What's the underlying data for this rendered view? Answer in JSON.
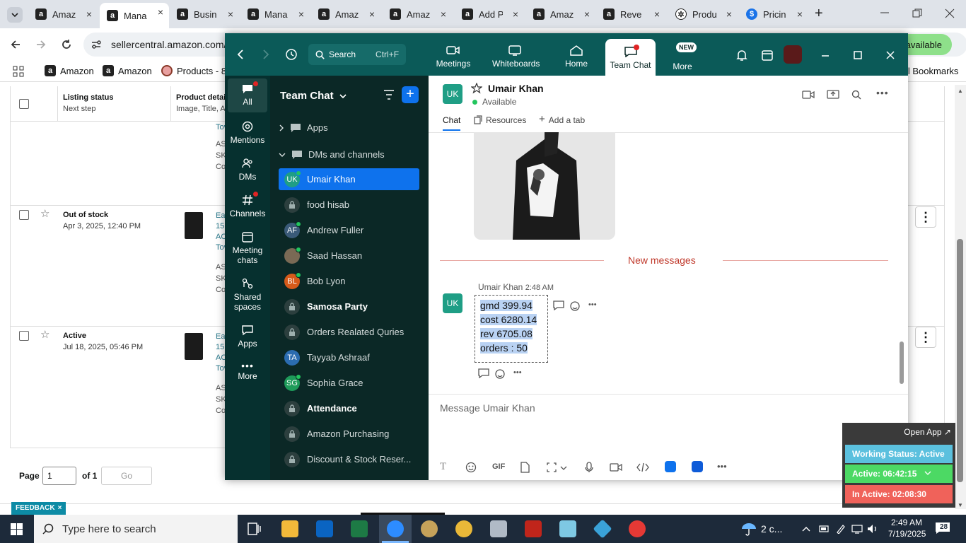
{
  "browser": {
    "tabs": [
      {
        "label": "Amaz",
        "icon": "a"
      },
      {
        "label": "Mana",
        "icon": "a"
      },
      {
        "label": "Busin",
        "icon": "a"
      },
      {
        "label": "Mana",
        "icon": "a"
      },
      {
        "label": "Amaz",
        "icon": "a"
      },
      {
        "label": "Amaz",
        "icon": "a"
      },
      {
        "label": "Add P",
        "icon": "a"
      },
      {
        "label": "Amaz",
        "icon": "a"
      },
      {
        "label": "Reve",
        "icon": "a"
      },
      {
        "label": "Produ",
        "icon": "globe"
      },
      {
        "label": "Pricin",
        "icon": "dollar"
      }
    ],
    "url": "sellercentral.amazon.com/",
    "bookmarks": [
      "Amazon",
      "Amazon",
      "Products - 88"
    ],
    "all_bookmarks": "ll Bookmarks",
    "available_pill": "available"
  },
  "amazon": {
    "headers": {
      "listing_status": "Listing status",
      "next_step": "Next step",
      "product_details": "Product detail",
      "product_sub": "Image, Title, A"
    },
    "rows": [
      {
        "status": "Out of stock",
        "date": "Apr 3, 2025, 12:40 PM"
      },
      {
        "status": "Active",
        "date": "Jul 18, 2025, 05:46 PM"
      }
    ],
    "cell_frag": {
      "to": "Tov",
      "as": "AS",
      "sk": "SK",
      "co": "Co",
      "ea": "Ea",
      "n15": "15",
      "ac": "AC"
    },
    "pagination": {
      "page_label": "Page",
      "page_value": "1",
      "of_label": "of 1",
      "go_label": "Go"
    },
    "feedback": "FEEDBACK"
  },
  "teams": {
    "search": {
      "label": "Search",
      "shortcut": "Ctrl+F"
    },
    "nav": [
      {
        "label": "Meetings"
      },
      {
        "label": "Whiteboards"
      },
      {
        "label": "Home"
      },
      {
        "label": "Team Chat"
      },
      {
        "label": "More",
        "badge": "NEW"
      }
    ],
    "rail": [
      {
        "label": "All"
      },
      {
        "label": "Mentions"
      },
      {
        "label": "DMs"
      },
      {
        "label": "Channels"
      },
      {
        "label": "Meeting chats"
      },
      {
        "label": "Shared spaces"
      },
      {
        "label": "Apps"
      },
      {
        "label": "More"
      }
    ],
    "panel_title": "Team Chat",
    "sections": {
      "apps": "Apps",
      "dms": "DMs and channels"
    },
    "channels": [
      {
        "name": "Umair Khan",
        "initials": "UK",
        "color": "#1f9e85",
        "type": "dm",
        "online": true
      },
      {
        "name": "food hisab",
        "type": "locked"
      },
      {
        "name": "Andrew Fuller",
        "initials": "AF",
        "color": "#3a5a78",
        "type": "dm",
        "online": true
      },
      {
        "name": "Saad Hassan",
        "initials": "",
        "color": "#7a6a55",
        "type": "dm",
        "online": true
      },
      {
        "name": "Bob Lyon",
        "initials": "BL",
        "color": "#d65a1a",
        "type": "dm",
        "online": true
      },
      {
        "name": "Samosa Party",
        "type": "locked",
        "bold": true
      },
      {
        "name": "Orders Realated Quries",
        "type": "locked"
      },
      {
        "name": "Tayyab Ashraaf",
        "initials": "TA",
        "color": "#2b6cb0",
        "type": "dm"
      },
      {
        "name": "Sophia Grace",
        "initials": "SG",
        "color": "#1e9b5a",
        "type": "dm",
        "online": true
      },
      {
        "name": "Attendance",
        "type": "locked",
        "bold": true
      },
      {
        "name": "Amazon Purchasing",
        "type": "locked"
      },
      {
        "name": "Discount & Stock Reser...",
        "type": "locked"
      }
    ],
    "chat": {
      "contact_initials": "UK",
      "contact_name": "Umair Khan",
      "presence": "Available",
      "tabs": [
        "Chat",
        "Resources",
        "Add a tab"
      ],
      "divider": "New messages",
      "message": {
        "sender": "Umair Khan",
        "time": "2:48 AM",
        "lines": [
          "gmd 399.94",
          "cost 6280.14",
          "rev 6705.08",
          "orders : 50"
        ]
      },
      "composer_placeholder": "Message Umair Khan",
      "gif_label": "GIF"
    }
  },
  "widget": {
    "open_app": "Open App ↗",
    "working_status": "Working Status: Active",
    "active": "Active: 06:42:15",
    "inactive": "In Active: 02:08:30"
  },
  "taskbar": {
    "search_placeholder": "Type here to search",
    "weather": "2 c...",
    "time": "2:49 AM",
    "date": "7/19/2025",
    "notifications": "28"
  },
  "colors": {
    "teams_accent": "#0e72ed",
    "teams_header": "#0b5a58",
    "new_messages": "#c0392b"
  }
}
